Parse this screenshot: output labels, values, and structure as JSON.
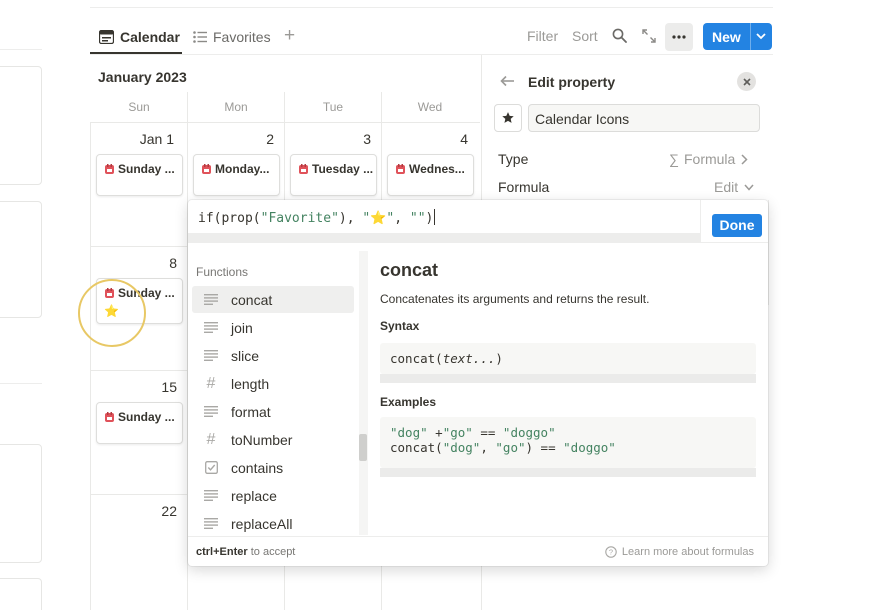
{
  "tabs": [
    {
      "label": "Calendar",
      "active": true
    },
    {
      "label": "Favorites",
      "active": false
    }
  ],
  "toolbar": {
    "filter": "Filter",
    "sort": "Sort",
    "new_label": "New"
  },
  "calendar": {
    "month": "January 2023",
    "weekdays": [
      "Sun",
      "Mon",
      "Tue",
      "Wed"
    ],
    "row1_days": [
      "Jan 1",
      "2",
      "3",
      "4"
    ],
    "row2_day": "8",
    "row3_day": "15",
    "row4_day": "22",
    "events": {
      "e1": "Sunday ...",
      "e2": "Monday...",
      "e3": "Tuesday ...",
      "e4": "Wednes...",
      "e5": "Sunday ...",
      "e6": "Sunday ..."
    },
    "star_glyph": "⭐"
  },
  "property_panel": {
    "title": "Edit property",
    "name_value": "Calendar Icons",
    "type_label": "Type",
    "type_value": "Formula",
    "type_symbol": "∑",
    "formula_label": "Formula",
    "formula_value": "Edit"
  },
  "formula_editor": {
    "formula_parts": {
      "p1": "if(prop(",
      "s1": "\"Favorite\"",
      "p2": "), ",
      "s2": "\"⭐\"",
      "p3": ", ",
      "s3": "\"\"",
      "p4": ")"
    },
    "done_label": "Done",
    "functions_heading": "Functions",
    "functions": [
      {
        "label": "concat",
        "icon": "text-lines-icon",
        "selected": true
      },
      {
        "label": "join",
        "icon": "text-lines-icon"
      },
      {
        "label": "slice",
        "icon": "text-lines-icon"
      },
      {
        "label": "length",
        "icon": "hash-icon"
      },
      {
        "label": "format",
        "icon": "text-lines-icon"
      },
      {
        "label": "toNumber",
        "icon": "hash-icon"
      },
      {
        "label": "contains",
        "icon": "checkbox-icon"
      },
      {
        "label": "replace",
        "icon": "text-lines-icon"
      },
      {
        "label": "replaceAll",
        "icon": "text-lines-icon"
      }
    ],
    "detail": {
      "title": "concat",
      "description": "Concatenates its arguments and returns the result.",
      "syntax_heading": "Syntax",
      "syntax_prefix": "concat(",
      "syntax_arg": "text...",
      "syntax_suffix": ")",
      "examples_heading": "Examples",
      "ex1_a": "\"dog\"",
      "ex1_b": " +",
      "ex1_c": "\"go\"",
      "ex1_d": " == ",
      "ex1_e": "\"doggo\"",
      "ex2_a": "concat(",
      "ex2_b": "\"dog\"",
      "ex2_c": ", ",
      "ex2_d": "\"go\"",
      "ex2_e": ") == ",
      "ex2_f": "\"doggo\""
    },
    "footer_keys": "ctrl+Enter",
    "footer_hint": " to accept",
    "footer_link": "Learn more about formulas"
  }
}
